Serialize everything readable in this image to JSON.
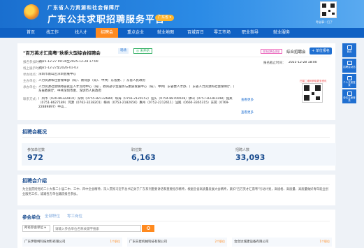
{
  "header": {
    "org_title": "广东省人力资源和社会保障厅",
    "site_title": "广东公共求职招聘服务平台",
    "region_pill": "广东省 ▾",
    "qr_caption": "粤省事一扫了"
  },
  "nav": {
    "items": [
      "首页",
      "找工作",
      "找人才",
      "招聘会",
      "重点企业",
      "就业地图",
      "百城百日",
      "零工市场",
      "职业指导",
      "就业服务"
    ],
    "active_index": 3
  },
  "fair": {
    "title": "\"百万英才汇南粤\"秋季大型综合招聘会",
    "badge": "现场",
    "status": "◎ 未开始",
    "type_pill": "现场招聘会类型",
    "type_label": "综合招聘会",
    "apply_button": "+ 单位报名",
    "rows": [
      {
        "label": "报名参加时间：",
        "value": "2025-12-27 09:30至2025-12-28 17:00"
      },
      {
        "label": "线上展示时间：",
        "value": "2025-12-27至2026-01-03"
      },
      {
        "label": "举办地点：",
        "value": "深圳市南山区深圳会展中心"
      },
      {
        "label": "主办单位：",
        "value": "人力资源和社会保障部（局）、教育部（局）、中共广东省委、广东省人民政府"
      },
      {
        "label": "承办单位：",
        "value": "人力资源社会保障部就业人才流动中心（局）、教育部学生服务与素质发展中心（局）、中共广东省委人才办、广东省人力资源和社会保障厅、广东省教育厅、中共深圳市委、深圳市人民政府"
      },
      {
        "label": "联系方式：",
        "value": "广州市（020-86322810）深圳（0755-82132689）珠海（0756-2120152）汕头（0754-88700028）佛山（0757-83381148）韶关（0751-8627189）河源（0762-3238201）梅州（0753-2182656）惠州（0752-2212611）汕尾（0660-3365315）东莞（0769-22889897）中山…"
      }
    ],
    "report_date_label": "报名截止时间：",
    "report_date": "2025-12-28 18:00",
    "qr_note": "扫描二维码获取更多资讯",
    "view_more_1": "查看更多",
    "view_more_2": "查看更多"
  },
  "overview": {
    "title": "招聘会概况",
    "stats": [
      {
        "label": "参加单位数",
        "value": "972"
      },
      {
        "label": "职位数",
        "value": "6,163"
      },
      {
        "label": "招聘人数",
        "value": "33,093"
      }
    ]
  },
  "intro": {
    "title": "招聘会介绍",
    "text": "为全面贯彻党的二十大和二十届二中、三中、四中全会精神，深入贯彻习近平总书记关于广东系列重要讲话和重要指示精神，根据全省高质量发展大会精神，紧扣\"百万英才汇南粤\"行动计划，高规格、高质量、高质量做好青年就业创业服务工作，诚邀各方单位踊跃报名参加。"
  },
  "units": {
    "tabs": [
      "参会单位",
      "全部职位",
      "零工岗位"
    ],
    "active_tab": 0,
    "filter_select": "所有参会单位 ▾",
    "search_placeholder": "请输入参会单位名称关键字搜索",
    "companies": [
      {
        "name": "广东伊斯柯科技材料有限公司",
        "tag": "1个职位"
      },
      {
        "name": "广东日星机械科技有限公司",
        "tag": "2个职位"
      },
      {
        "name": "合合达城建设备有限公司",
        "tag": "1个职位"
      }
    ]
  },
  "sidebar": {
    "items": [
      "首页",
      "招聘会动态",
      "个人注册登录",
      "单位注册登录"
    ]
  }
}
